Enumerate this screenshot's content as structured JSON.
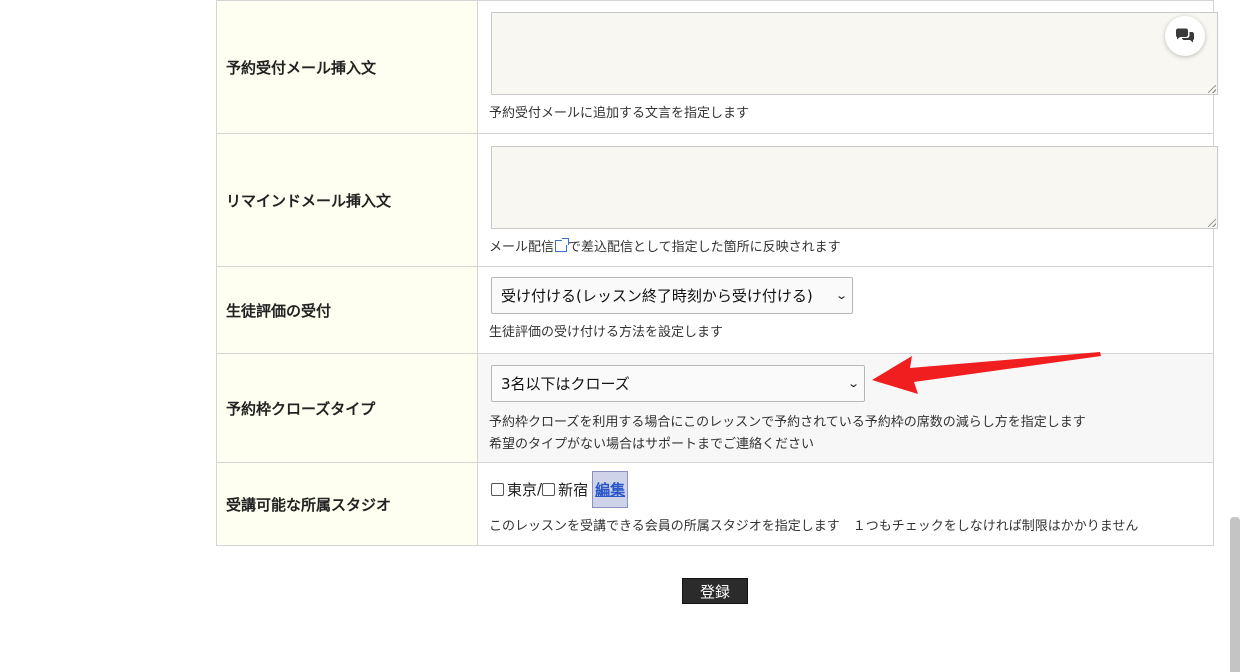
{
  "form": {
    "rows": [
      {
        "label": "予約受付メール挿入文",
        "textarea_value": "",
        "help": "予約受付メールに追加する文言を指定します"
      },
      {
        "label": "リマインドメール挿入文",
        "textarea_value": "",
        "help_link": "メール配信",
        "help_rest": "で差込配信として指定した箇所に反映されます"
      },
      {
        "label": "生徒評価の受付",
        "selected": "受け付ける(レッスン終了時刻から受け付ける)",
        "help": "生徒評価の受け付ける方法を設定します"
      },
      {
        "label": "予約枠クローズタイプ",
        "selected": "3名以下はクローズ",
        "help_line1": "予約枠クローズを利用する場合にこのレッスンで予約されている予約枠の席数の減らし方を指定します",
        "help_line2": "希望のタイプがない場合はサポートまでご連絡ください"
      },
      {
        "label": "受講可能な所属スタジオ",
        "options": [
          {
            "label": "東京",
            "checked": false
          },
          {
            "label": "新宿",
            "checked": false
          }
        ],
        "separator": "/",
        "edit_link": "編集",
        "help": "このレッスンを受講できる会員の所属スタジオを指定します　１つもチェックをしなければ制限はかかりません"
      }
    ]
  },
  "submit_label": "登録",
  "icons": {
    "chat": "chat-bubbles-icon",
    "external_link": "external-link-icon",
    "chevron": "chevron-down-icon",
    "annotation": "red-arrow-annotation"
  },
  "colors": {
    "label_bg": "#fefff0",
    "annotation_arrow": "#f01e1e",
    "submit_bg": "#2b2b2b",
    "link": "#2a58c9"
  }
}
